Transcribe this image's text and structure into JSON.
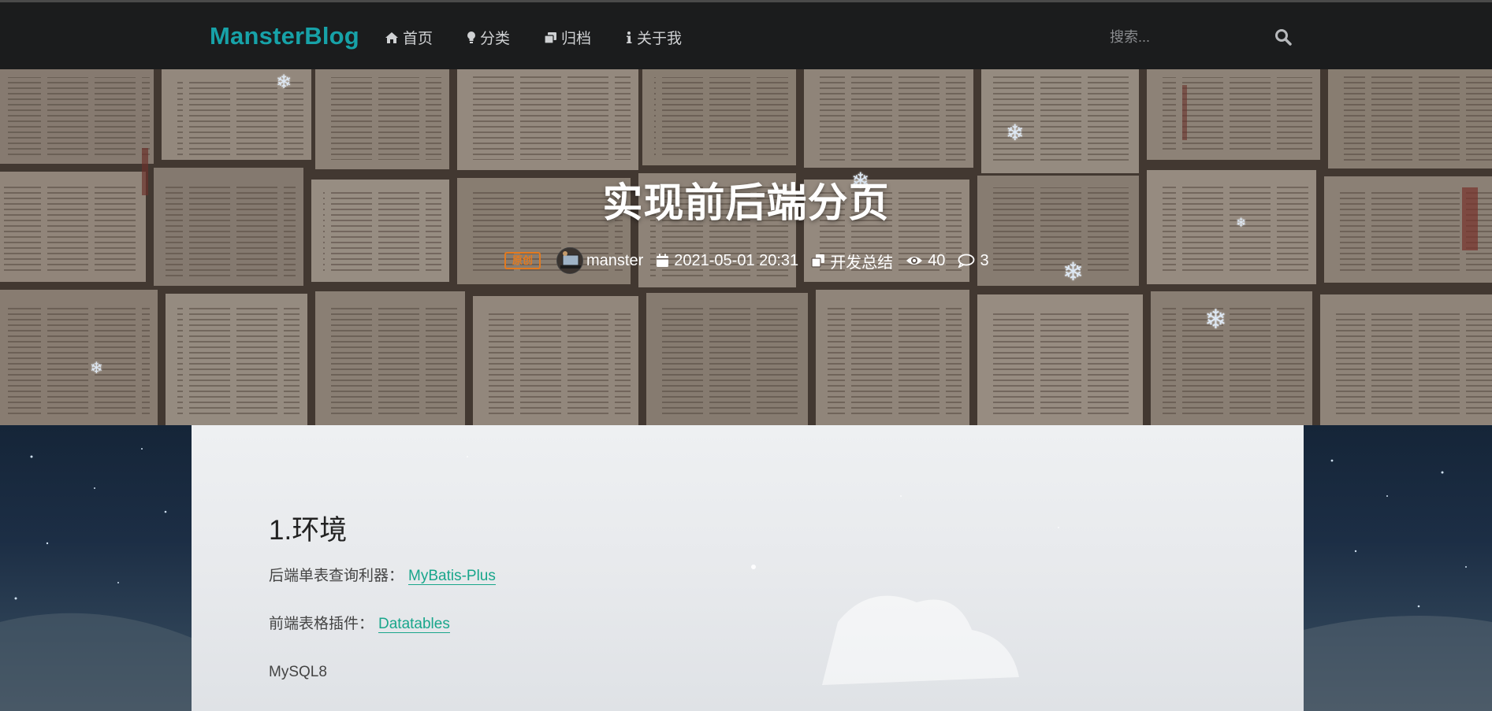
{
  "nav": {
    "brand": "MansterBlog",
    "items": [
      {
        "label": "首页",
        "icon": "home-icon"
      },
      {
        "label": "分类",
        "icon": "lightbulb-icon"
      },
      {
        "label": "归档",
        "icon": "clone-icon"
      },
      {
        "label": "关于我",
        "icon": "info-icon"
      }
    ],
    "search_placeholder": "搜索...",
    "search_icon": "search-icon"
  },
  "post": {
    "title": "实现前后端分页",
    "tag": "原创",
    "author": "manster",
    "date": "2021-05-01 20:31",
    "category": "开发总结",
    "views": "40",
    "comments": "3"
  },
  "content": {
    "heading": "1.环境",
    "paragraphs": [
      {
        "prefix": "后端单表查询利器：",
        "link": "MyBatis-Plus"
      },
      {
        "prefix": "前端表格插件：",
        "link": "Datatables"
      },
      {
        "text": "MySQL8"
      }
    ]
  },
  "colors": {
    "brand": "#17a2a8",
    "navbar_bg": "#1b1c1d",
    "tag_orange": "#e37a1f",
    "link_green": "#19a68b"
  }
}
